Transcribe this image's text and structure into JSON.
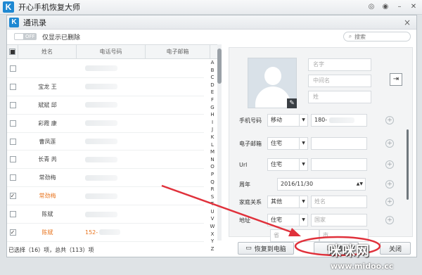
{
  "app": {
    "title": "开心手机恢复大师",
    "logo": "K",
    "controls": [
      {
        "icon": "wechat-icon",
        "glyph": "◎"
      },
      {
        "icon": "chat-icon",
        "glyph": "◉"
      },
      {
        "icon": "minimize-icon",
        "glyph": "–"
      },
      {
        "icon": "close-icon",
        "glyph": "✕"
      }
    ]
  },
  "dialog": {
    "title": "通讯录",
    "logo": "K",
    "close": "×",
    "toggle_text": "OFF",
    "toggle_label": "仅显示已删除",
    "search_placeholder": "搜索"
  },
  "list": {
    "columns": [
      "姓名",
      "电话号码",
      "电子邮箱"
    ],
    "rows": [
      {
        "name": "",
        "checked": false,
        "phone": "",
        "has_phone": true
      },
      {
        "name": "宝龙 王",
        "checked": false,
        "phone": "",
        "has_phone": true
      },
      {
        "name": "斌斌 邱",
        "checked": false,
        "phone": "",
        "has_phone": true
      },
      {
        "name": "彩霞 康",
        "checked": false,
        "phone": "",
        "has_phone": true
      },
      {
        "name": "曹凤莲",
        "checked": false,
        "phone": "",
        "has_phone": true
      },
      {
        "name": "长青 芮",
        "checked": false,
        "phone": "",
        "has_phone": true
      },
      {
        "name": "常劲梅",
        "checked": false,
        "phone": "",
        "has_phone": true
      },
      {
        "name": "常劲梅",
        "checked": true,
        "phone": "",
        "has_phone": true
      },
      {
        "name": "陈斌",
        "checked": false,
        "phone": "",
        "has_phone": true
      },
      {
        "name": "陈斌",
        "checked": true,
        "phone": "152-",
        "has_phone": true
      }
    ],
    "alphabet": [
      "A",
      "B",
      "C",
      "D",
      "E",
      "F",
      "G",
      "H",
      "I",
      "J",
      "K",
      "L",
      "M",
      "N",
      "O",
      "P",
      "Q",
      "R",
      "S",
      "T",
      "U",
      "V",
      "W",
      "X",
      "Y",
      "Z"
    ]
  },
  "detail": {
    "name_placeholders": [
      "名字",
      "中间名",
      "姓"
    ],
    "fields": [
      {
        "label": "手机号码",
        "type": "移动",
        "value": "180-"
      },
      {
        "label": "电子邮箱",
        "type": "住宅",
        "value": ""
      },
      {
        "label": "Url",
        "type": "住宅",
        "value": ""
      },
      {
        "label": "周年",
        "type": "",
        "value": "2016/11/30"
      },
      {
        "label": "家庭关系",
        "type": "其他",
        "value": "姓名"
      },
      {
        "label": "地址",
        "type": "住宅",
        "value": "国家"
      }
    ],
    "address_placeholders": [
      "省",
      "市"
    ]
  },
  "footer": {
    "status": "已选择（16）项，总共（113）项",
    "btn_restore_pc": "恢复到电脑",
    "btn_restore_device": "恢复",
    "btn_close": "关闭"
  },
  "watermark": {
    "text": "咪咪网",
    "url": "www.midoo.cc"
  },
  "colors": {
    "accent_orange": "#e8741e",
    "brand_blue": "#1e88d2",
    "annotation_red": "#e0313b"
  }
}
